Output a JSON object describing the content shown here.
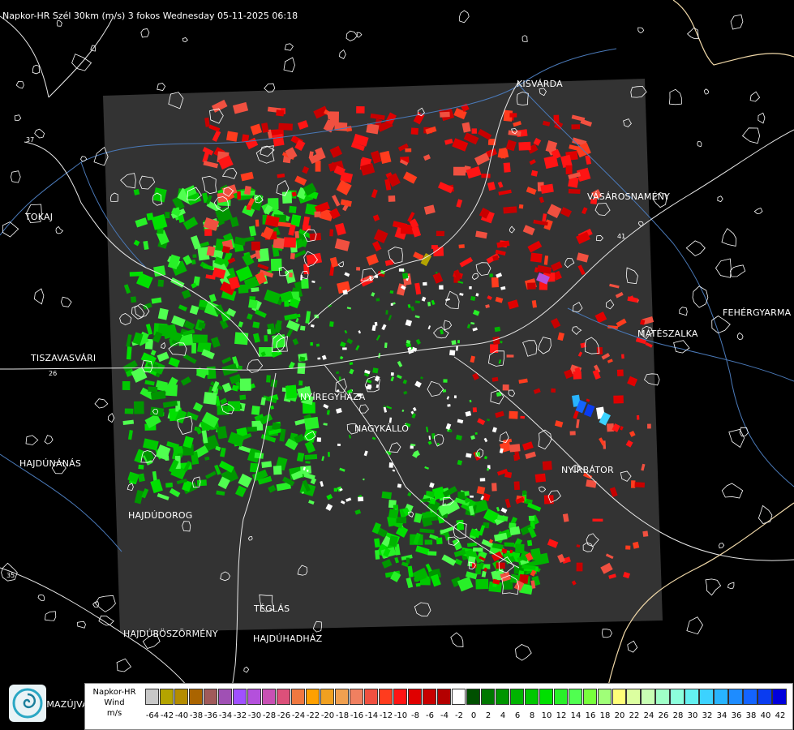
{
  "title": "Napkor-HR Szél 30km (m/s) 3 fokos Wednesday 05-11-2025 06:18",
  "places": [
    {
      "id": "kisvarda",
      "name": "KISVÁRDA"
    },
    {
      "id": "tokaj",
      "name": "TOKAJ"
    },
    {
      "id": "vasarosnameny",
      "name": "VÁSÁROSNAMÉNY"
    },
    {
      "id": "fehergyarmat",
      "name": "FEHÉRGYARMA"
    },
    {
      "id": "mateszalka",
      "name": "MÁTÉSZALKA"
    },
    {
      "id": "tiszavasvari",
      "name": "TISZAVASVÁRI"
    },
    {
      "id": "nyiregyhaza",
      "name": "NYÍREGYHÁZA"
    },
    {
      "id": "nagykallo",
      "name": "NAGYKÁLLÓ"
    },
    {
      "id": "hajdunanas",
      "name": "HAJDÚNÁNÁS"
    },
    {
      "id": "nyirbator",
      "name": "NYÍRBÁTOR"
    },
    {
      "id": "hajdudorog",
      "name": "HAJDÚDOROG"
    },
    {
      "id": "teglas",
      "name": "TÉGLÁS"
    },
    {
      "id": "hajduboszormeny",
      "name": "HAJDÚBÖSZÖRMÉNY"
    },
    {
      "id": "hajduhadhaz",
      "name": "HAJDÚHADHÁZ"
    },
    {
      "id": "balmazujvaros",
      "name": "LMAZÚJVÁR"
    }
  ],
  "roads": [
    "37",
    "26",
    "41",
    "35"
  ],
  "legend": {
    "line1": "Napkor-HR",
    "line2": "Wind",
    "line3": "m/s",
    "ticks": [
      "-64",
      "-42",
      "-40",
      "-38",
      "-36",
      "-34",
      "-32",
      "-30",
      "-28",
      "-26",
      "-24",
      "-22",
      "-20",
      "-18",
      "-16",
      "-14",
      "-12",
      "-10",
      "-8",
      "-6",
      "-4",
      "-2",
      "0",
      "2",
      "4",
      "6",
      "8",
      "10",
      "12",
      "14",
      "16",
      "18",
      "20",
      "22",
      "24",
      "26",
      "28",
      "30",
      "32",
      "34",
      "36",
      "38",
      "40",
      "42"
    ],
    "colors": [
      "#c8c8c8",
      "#b4a400",
      "#b48c00",
      "#aa6400",
      "#a05a5a",
      "#a050b4",
      "#a050ff",
      "#b450dc",
      "#c850b4",
      "#dc507a",
      "#f07840",
      "#ffa000",
      "#f0a020",
      "#f0a050",
      "#f08060",
      "#f05040",
      "#ff3c1e",
      "#ff1414",
      "#e00000",
      "#c80000",
      "#b40000",
      "#ffffff",
      "#005000",
      "#007800",
      "#009600",
      "#00b400",
      "#00c800",
      "#00e000",
      "#28f028",
      "#50ff50",
      "#78ff3c",
      "#a0ff78",
      "#ffff78",
      "#dcffa0",
      "#c8ffb4",
      "#a0ffc8",
      "#8cffdc",
      "#64f0f0",
      "#3cd2ff",
      "#28b4ff",
      "#1e8cff",
      "#1464ff",
      "#0a3cf0",
      "#0000dc"
    ]
  }
}
